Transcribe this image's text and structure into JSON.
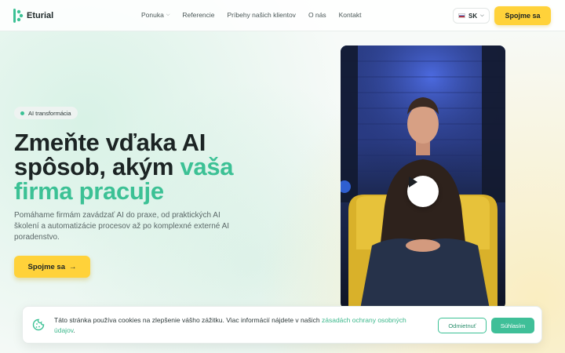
{
  "brand": {
    "name": "Eturial",
    "accent": "#3cc195",
    "cta_color": "#ffd23a"
  },
  "nav": {
    "items": [
      {
        "label": "Ponuka",
        "has_dropdown": true
      },
      {
        "label": "Referencie"
      },
      {
        "label": "Príbehy našich klientov"
      },
      {
        "label": "O nás"
      },
      {
        "label": "Kontakt"
      }
    ],
    "language": {
      "code": "SK",
      "icon": "flag-sk-icon"
    },
    "cta": "Spojme sa"
  },
  "hero": {
    "badge": "AI transformácia",
    "headline_plain": "Zmeňte vďaka AI spôsob, akým ",
    "headline_accent": "vaša firma pracuje",
    "lede": "Pomáhame firmám zavádzať AI do praxe, od praktických AI školení a automatizácie procesov až po komplexné externé AI poradenstvo.",
    "cta": "Spojme sa",
    "cta_icon": "arrow-right-icon"
  },
  "video": {
    "play_icon": "play-icon"
  },
  "cookie_banner": {
    "text": "Táto stránka používa cookies na zlepšenie vášho zážitku. Viac informácií nájdete v našich ",
    "link": "zásadách ochrany osobných údajov",
    "suffix": ".",
    "decline": "Odmietnuť",
    "accept": "Súhlasím",
    "icon": "cookie-icon"
  }
}
